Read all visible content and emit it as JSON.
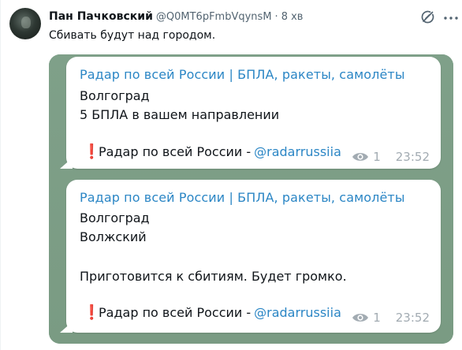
{
  "post": {
    "author_name": "Пан Пачковский",
    "author_handle": "@Q0MT6pFmbVqynsM",
    "separator": "·",
    "time": "8 хв",
    "text": "Сбивать будут над городом."
  },
  "icons": {
    "grok": "grok-icon",
    "more": "more-icon",
    "views": "eye-icon",
    "alert": "exclamation-icon"
  },
  "media": {
    "messages": [
      {
        "channel_title": "Радар по всей России | БПЛА, ракеты, самолёты",
        "lines": [
          "Волгоград",
          "5 БПЛА в вашем направлении"
        ],
        "alert_mark": "❗",
        "signature_text": "Радар по всей России -",
        "signature_link": "@radarrussiia",
        "views": "1",
        "time": "23:52"
      },
      {
        "channel_title": "Радар по всей России | БПЛА, ракеты, самолёты",
        "lines": [
          "Волгоград",
          "Волжский",
          "Приготовится к сбитиям. Будет громко."
        ],
        "alert_mark": "❗",
        "signature_text": "Радар по всей России -",
        "signature_link": "@radarrussiia",
        "views": "1",
        "time": "23:52"
      }
    ]
  },
  "colors": {
    "link_blue": "#2b86c5",
    "alert_red": "#d7262a",
    "chat_background": "#7c9d86",
    "meta_gray": "#a2abb2"
  }
}
